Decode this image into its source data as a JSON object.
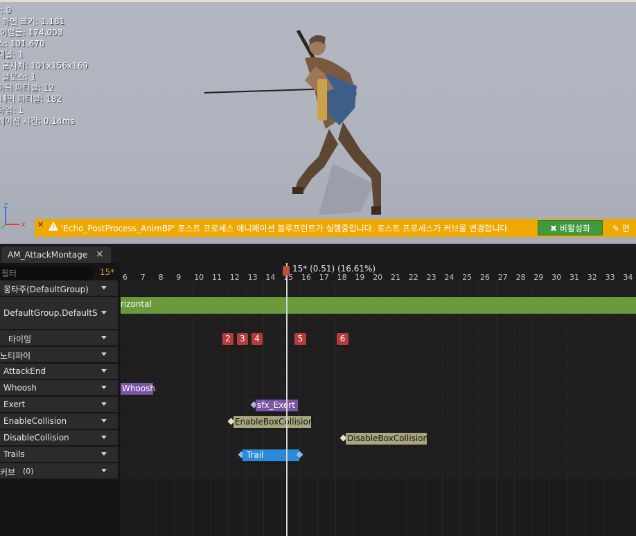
{
  "viewport": {
    "stats": [
      "",
      "r: 0",
      "l 화면 크기: 1.181",
      "·이앵글: 174,003",
      "스: 101,670",
      "재널: 1",
      "l 군사치: 101x156x169",
      "i 클로스: 1",
      "마틱 파티클: 12",
      "i내믹 파티클: 182",
      "작업: 1",
      "레이션 시간: 0.14ms"
    ],
    "axis": {
      "z": "Z",
      "x": "X",
      "y": "Y"
    },
    "warning": {
      "close": "✕",
      "message": "'Echo_PostProcess_AnimBP' 포스트 프로세스 애니메이션 블루프린트가 실행중입니다. 포스트 프로세스가 커브를 변경합니다.",
      "button": "✖ 비활성화",
      "extra": "✎ 편"
    }
  },
  "tab": {
    "title": "AM_AttackMontage",
    "close": "×"
  },
  "panel": {
    "filter_placeholder": "필터",
    "frame_indicator": "15*",
    "tracks": [
      {
        "label": "몽타주(DefaultGroup)"
      },
      {
        "label": "DefaultGroup.DefaultS"
      },
      {
        "label": "타이밍"
      },
      {
        "label": "노티파이"
      },
      {
        "label": "AttackEnd"
      },
      {
        "label": "Whoosh"
      },
      {
        "label": "Exert"
      },
      {
        "label": "EnableCollision"
      },
      {
        "label": "DisableCollision"
      },
      {
        "label": "Trails"
      },
      {
        "label": "커브",
        "count": "(0)"
      }
    ]
  },
  "timeline": {
    "ticks": [
      "6",
      "7",
      "8",
      "9",
      "10",
      "11",
      "12",
      "13",
      "14",
      "15",
      "16",
      "17",
      "18",
      "19",
      "20",
      "21",
      "22",
      "23",
      "24",
      "25",
      "26",
      "27",
      "28",
      "29",
      "30",
      "31",
      "32",
      "33",
      "34"
    ],
    "playhead": "15* (0.51) (16.61%)",
    "montage_segment": "rizontal",
    "sections": [
      "2",
      "3",
      "4",
      "5",
      "6"
    ],
    "notifies": {
      "whoosh": "Whoosh",
      "exert": "sfx_Exert",
      "enable": "EnableBoxCollision",
      "disable": "DisableBoxCollision",
      "trail": "Trail"
    }
  },
  "colors": {
    "warning_bg": "#f0a800",
    "disable_button": "#3e9a3c",
    "montage_bar": "#6b9a3a",
    "section": "#b83b3b",
    "notify_purple": "#7b54a8",
    "notify_olive": "#a8a67e",
    "trail_blue": "#2d8ad8",
    "frame_indicator": "#e5a128"
  }
}
